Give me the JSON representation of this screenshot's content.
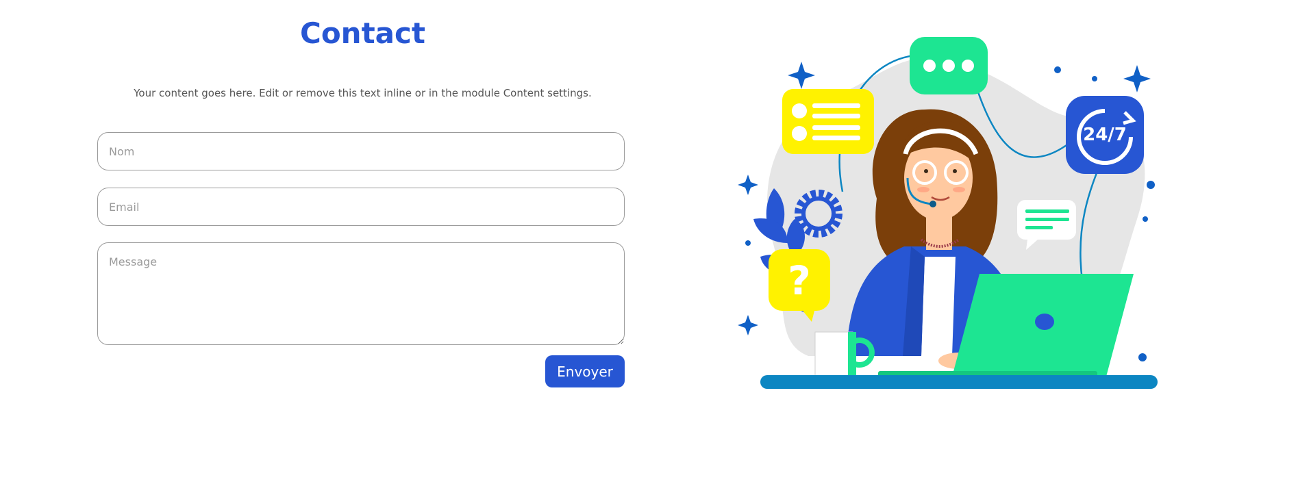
{
  "contact": {
    "title": "Contact",
    "intro": "Your content goes here. Edit or remove this text inline or in the module Content settings.",
    "fields": {
      "name_placeholder": "Nom",
      "email_placeholder": "Email",
      "message_placeholder": "Message"
    },
    "submit_label": "Envoyer"
  },
  "illustration": {
    "badge_247": "24/7",
    "question_mark": "?",
    "colors": {
      "primary_blue": "#2756d3",
      "green": "#1de592",
      "yellow": "#fff200",
      "hair": "#7b3f0a",
      "skin": "#ffc9a0",
      "desk": "#0c86c2"
    }
  }
}
